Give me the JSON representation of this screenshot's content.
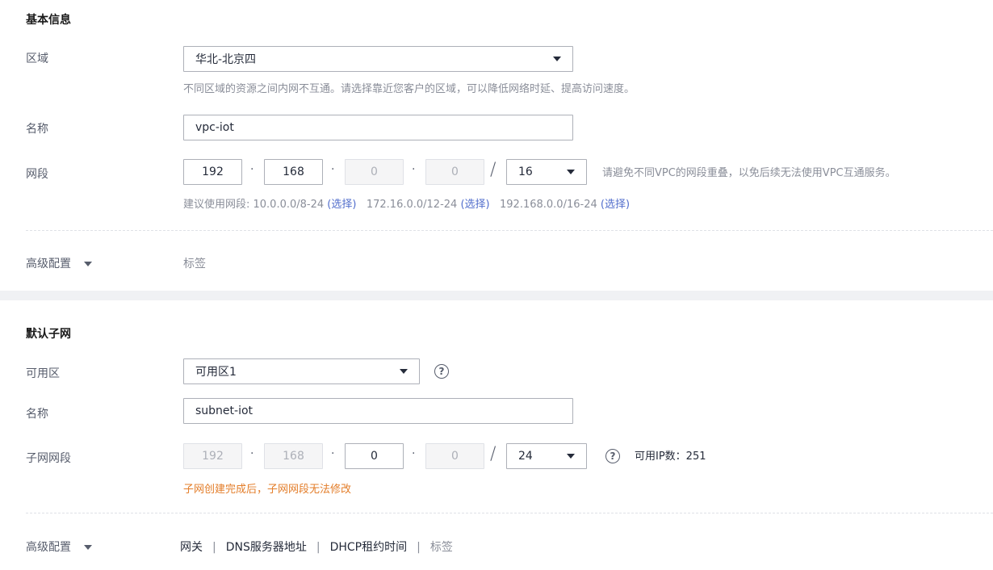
{
  "basic": {
    "title": "基本信息",
    "region": {
      "label": "区域",
      "value": "华北-北京四",
      "hint": "不同区域的资源之间内网不互通。请选择靠近您客户的区域，可以降低网络时延、提高访问速度。"
    },
    "name": {
      "label": "名称",
      "value": "vpc-iot"
    },
    "cidr": {
      "label": "网段",
      "octets": [
        "192",
        "168",
        "0",
        "0"
      ],
      "mask": "16",
      "warning": "请避免不同VPC的网段重叠，以免后续无法使用VPC互通服务。",
      "suggest_prefix": "建议使用网段: 10.0.0.0/8-24",
      "select_label": "(选择)",
      "suggest_2": "172.16.0.0/12-24",
      "suggest_3": "192.168.0.0/16-24"
    },
    "advanced": {
      "label": "高级配置",
      "tags": "标签"
    }
  },
  "subnet": {
    "title": "默认子网",
    "az": {
      "label": "可用区",
      "value": "可用区1",
      "help": "?"
    },
    "name": {
      "label": "名称",
      "value": "subnet-iot"
    },
    "cidr": {
      "label": "子网网段",
      "octets": [
        "192",
        "168",
        "0",
        "0"
      ],
      "mask": "24",
      "available": "可用IP数：251",
      "warning": "子网创建完成后，子网网段无法修改"
    },
    "advanced": {
      "label": "高级配置",
      "items": [
        "网关",
        "DNS服务器地址",
        "DHCP租约时间",
        "标签"
      ]
    }
  }
}
